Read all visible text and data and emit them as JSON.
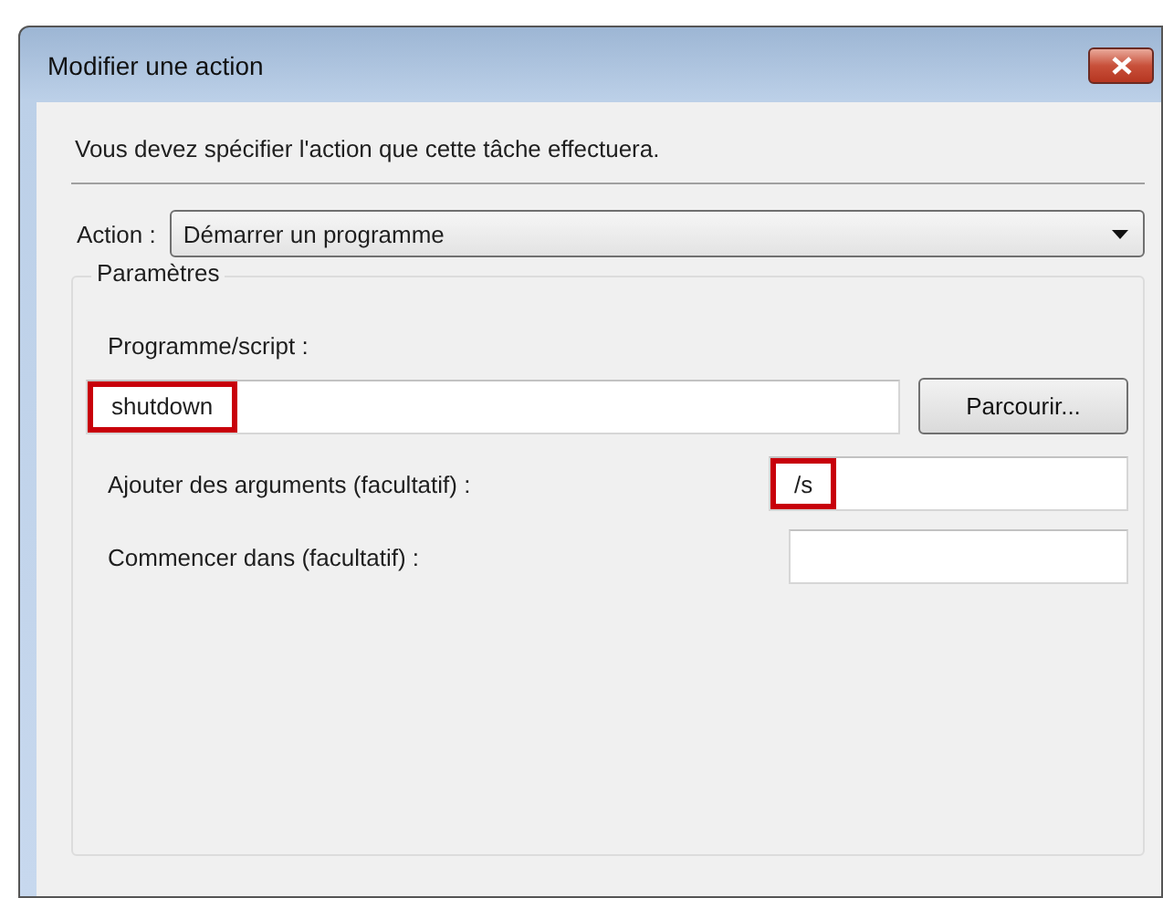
{
  "window": {
    "title": "Modifier une action"
  },
  "instruction": "Vous devez spécifier l'action que cette tâche effectuera.",
  "action": {
    "label": "Action :",
    "value": "Démarrer un programme"
  },
  "parameters": {
    "title": "Paramètres",
    "program": {
      "label": "Programme/script :",
      "value": "shutdown",
      "highlighted": true
    },
    "browse_button": "Parcourir...",
    "arguments": {
      "label": "Ajouter des arguments (facultatif) :",
      "value": "/s",
      "highlighted": true
    },
    "start_in": {
      "label": "Commencer dans (facultatif) :",
      "highlighted": false
    }
  }
}
